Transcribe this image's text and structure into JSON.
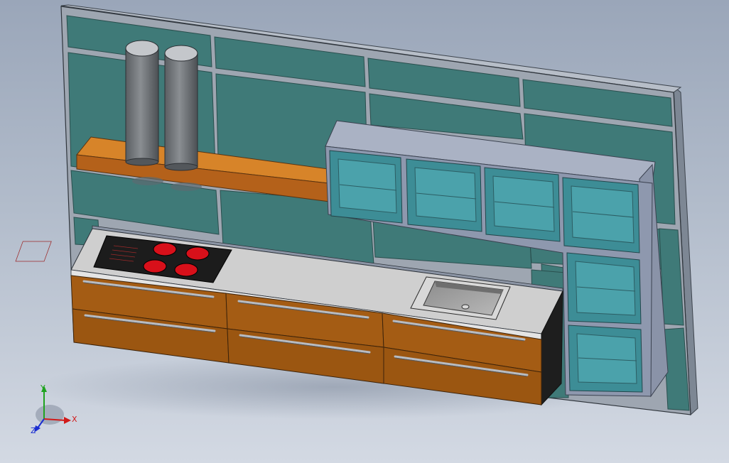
{
  "viewport": {
    "background_top": "#9aa6b9",
    "background_bottom": "#d3d9e3"
  },
  "model": {
    "wall_color": "#3f7a78",
    "wall_frame_color": "#9ea6b1",
    "shelf_wood_color": "#c8731c",
    "cabinet_wood_color": "#a45c14",
    "countertop_color": "#cfcfcf",
    "glass_cube_color": "#4a9ba3",
    "cube_frame_color": "#8e98ae",
    "hob_burner_color": "#d8101a",
    "canister_color": "#666a6e"
  },
  "triad": {
    "x_label": "X",
    "y_label": "Y",
    "z_label": "Z",
    "x_color": "#d11a1a",
    "y_color": "#1fa31f",
    "z_color": "#1a2dd1"
  }
}
